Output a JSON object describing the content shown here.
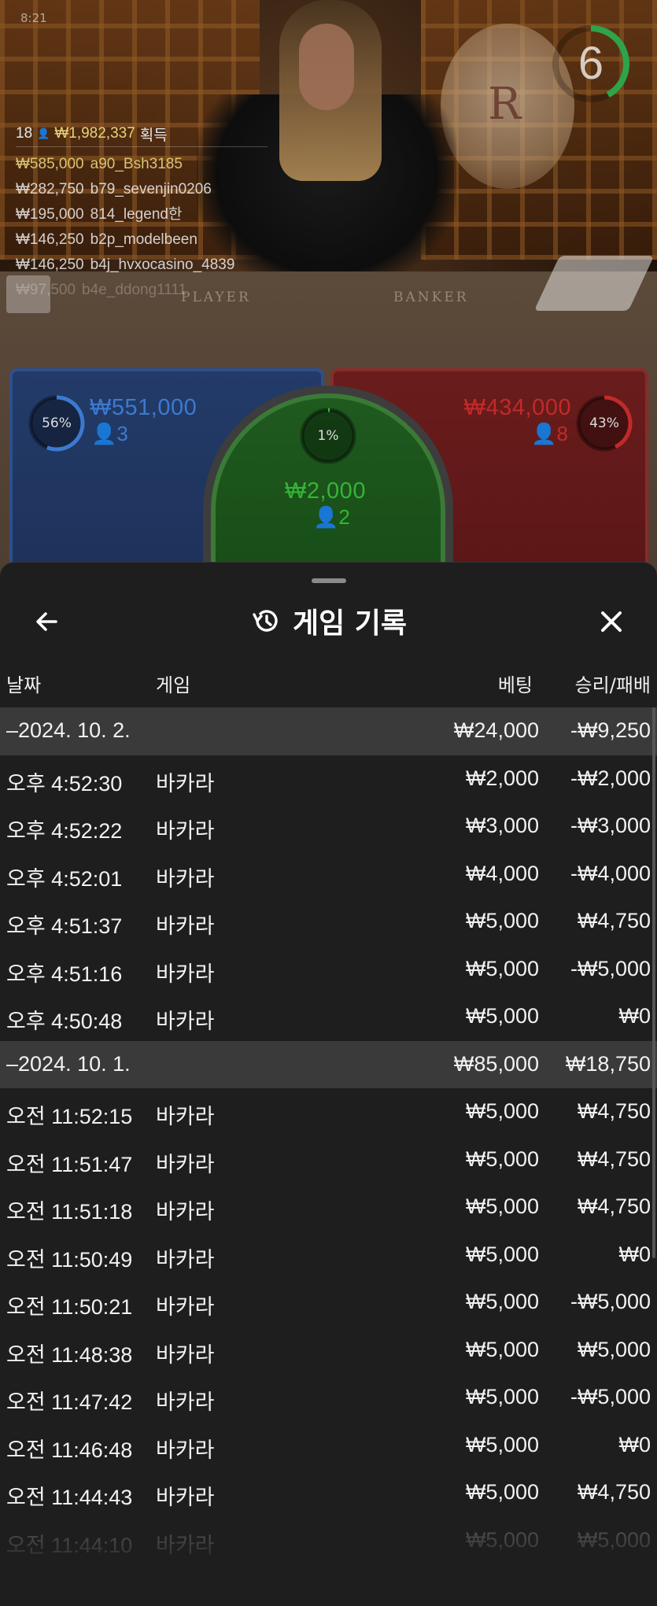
{
  "table": {
    "timer": "6",
    "tiny_id": "8:21",
    "felt_player": "PLAYER",
    "felt_banker": "BANKER",
    "logo_letter": "R",
    "winners": {
      "count": "18",
      "total": "₩1,982,337",
      "suffix": "획득",
      "rows": [
        {
          "amount": "₩585,000",
          "nick": "a90_Bsh3185",
          "highlight": true
        },
        {
          "amount": "₩282,750",
          "nick": "b79_sevenjin0206",
          "highlight": false
        },
        {
          "amount": "₩195,000",
          "nick": "814_legend한",
          "highlight": false
        },
        {
          "amount": "₩146,250",
          "nick": "b2p_modelbeen",
          "highlight": false
        },
        {
          "amount": "₩146,250",
          "nick": "b4j_hvxocasino_4839",
          "highlight": false
        },
        {
          "amount": "₩97,500",
          "nick": "b4e_ddong1111",
          "highlight": false
        }
      ]
    },
    "spots": {
      "player": {
        "pct": "56%",
        "pct_value": 56,
        "amount": "₩551,000",
        "count": "3",
        "color": "#3c7ad0"
      },
      "tie": {
        "pct": "1%",
        "pct_value": 1,
        "amount": "₩2,000",
        "count": "2",
        "color": "#35b535"
      },
      "banker": {
        "pct": "43%",
        "pct_value": 43,
        "amount": "₩434,000",
        "count": "8",
        "color": "#c22a2a"
      }
    }
  },
  "sheet": {
    "title": "게임 기록",
    "icons": {
      "back": "arrow-left-icon",
      "history": "history-icon",
      "close": "close-icon"
    },
    "columns": {
      "date": "날짜",
      "game": "게임",
      "bet": "베팅",
      "result": "승리/패배"
    },
    "groups": [
      {
        "date": "–2024. 10. 2.",
        "bet": "₩24,000",
        "result": "-₩9,250",
        "rows": [
          {
            "time": "오후 4:52:30",
            "game": "바카라",
            "bet": "₩2,000",
            "result": "-₩2,000"
          },
          {
            "time": "오후 4:52:22",
            "game": "바카라",
            "bet": "₩3,000",
            "result": "-₩3,000"
          },
          {
            "time": "오후 4:52:01",
            "game": "바카라",
            "bet": "₩4,000",
            "result": "-₩4,000"
          },
          {
            "time": "오후 4:51:37",
            "game": "바카라",
            "bet": "₩5,000",
            "result": "₩4,750"
          },
          {
            "time": "오후 4:51:16",
            "game": "바카라",
            "bet": "₩5,000",
            "result": "-₩5,000"
          },
          {
            "time": "오후 4:50:48",
            "game": "바카라",
            "bet": "₩5,000",
            "result": "₩0"
          }
        ]
      },
      {
        "date": "–2024. 10. 1.",
        "bet": "₩85,000",
        "result": "₩18,750",
        "rows": [
          {
            "time": "오전 11:52:15",
            "game": "바카라",
            "bet": "₩5,000",
            "result": "₩4,750"
          },
          {
            "time": "오전 11:51:47",
            "game": "바카라",
            "bet": "₩5,000",
            "result": "₩4,750"
          },
          {
            "time": "오전 11:51:18",
            "game": "바카라",
            "bet": "₩5,000",
            "result": "₩4,750"
          },
          {
            "time": "오전 11:50:49",
            "game": "바카라",
            "bet": "₩5,000",
            "result": "₩0"
          },
          {
            "time": "오전 11:50:21",
            "game": "바카라",
            "bet": "₩5,000",
            "result": "-₩5,000"
          },
          {
            "time": "오전 11:48:38",
            "game": "바카라",
            "bet": "₩5,000",
            "result": "₩5,000"
          },
          {
            "time": "오전 11:47:42",
            "game": "바카라",
            "bet": "₩5,000",
            "result": "-₩5,000"
          },
          {
            "time": "오전 11:46:48",
            "game": "바카라",
            "bet": "₩5,000",
            "result": "₩0"
          },
          {
            "time": "오전 11:44:43",
            "game": "바카라",
            "bet": "₩5,000",
            "result": "₩4,750"
          },
          {
            "time": "오전 11:44:10",
            "game": "바카라",
            "bet": "₩5,000",
            "result": "₩5,000"
          }
        ]
      }
    ]
  }
}
